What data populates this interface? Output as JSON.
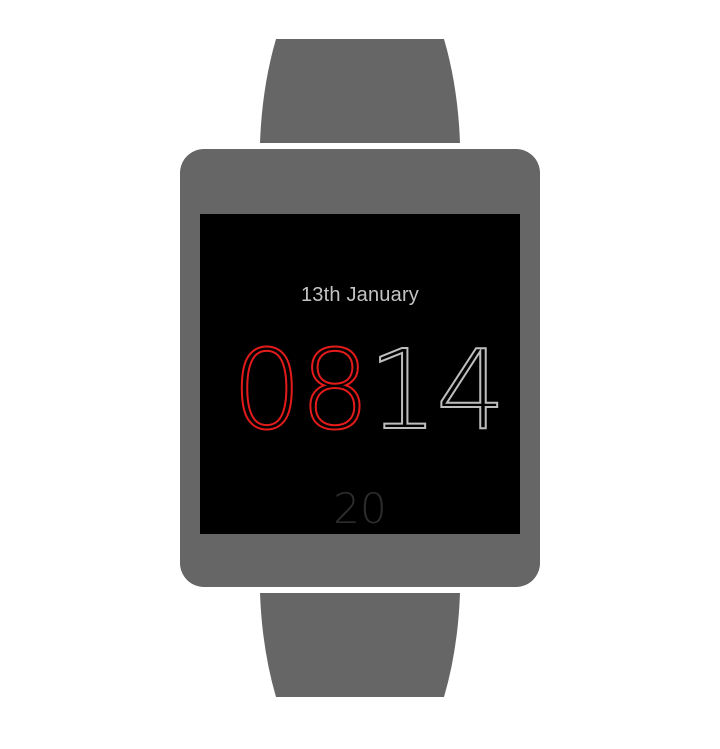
{
  "watch_face": {
    "date": "13th January",
    "hours": "08",
    "minutes": "14",
    "seconds": "20"
  },
  "colors": {
    "hours": "#e31b1b",
    "minutes": "#bdbdbd",
    "seconds": "#2c2c2c",
    "date": "#c4c4c4",
    "screen": "#000000",
    "body": "#666666"
  }
}
